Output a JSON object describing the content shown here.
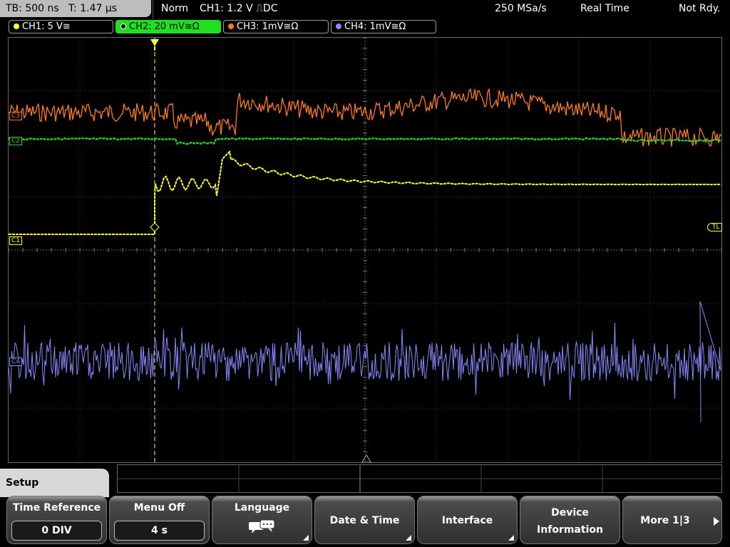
{
  "status_bar": {
    "timebase": "TB: 500 ns",
    "trigger_time": "T: 1.47 µs",
    "acq_mode": "Norm",
    "trigger_info": "CH1: 1.2 V",
    "trigger_slope_coupling": "⎍DC",
    "sample_rate": "250 MSa/s",
    "mode": "Real Time",
    "ready_state": "Not Rdy."
  },
  "channels": [
    {
      "label": "CH1: 5 V≅",
      "color": "#ffff33",
      "marker": "C1"
    },
    {
      "label": "CH2: 20 mV≅Ω",
      "color": "#22dd22",
      "marker": "C2"
    },
    {
      "label": "CH3: 1mV≅Ω",
      "color": "#ff7a1a",
      "marker": "C3"
    },
    {
      "label": "CH4: 1mV≅Ω",
      "color": "#8888ff",
      "marker": "C4"
    }
  ],
  "markers": {
    "trigger_level": "TL"
  },
  "menu": {
    "title": "Setup",
    "softkeys": [
      {
        "label": "Time Reference",
        "value": "0 DIV"
      },
      {
        "label": "Menu Off",
        "value": "4 s"
      },
      {
        "label": "Language",
        "icon": "speech-bubbles-icon"
      },
      {
        "label": "Date & Time"
      },
      {
        "label": "Interface"
      },
      {
        "label": "Device",
        "label2": "Information"
      },
      {
        "label": "More 1|3",
        "icon": "play-arrow-icon"
      }
    ]
  }
}
